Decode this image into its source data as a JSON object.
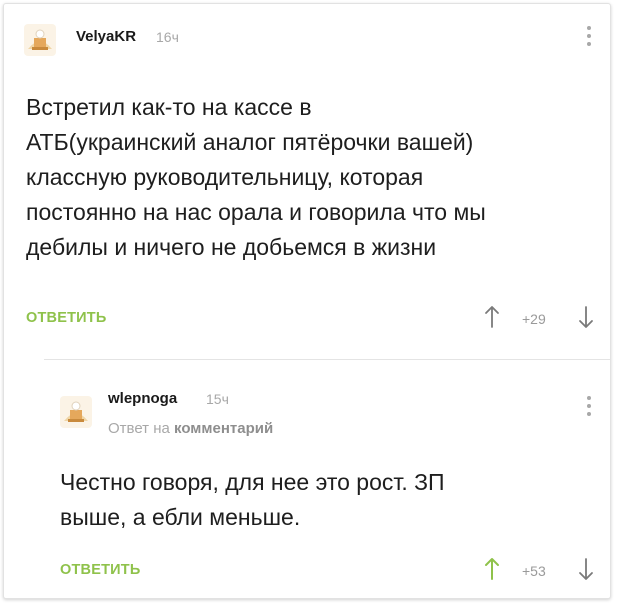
{
  "comment1": {
    "username": "VelyaKR",
    "time": "16ч",
    "text_lines": [
      "Встретил как-то на кассе в",
      "АТБ(украинский аналог пятёрочки вашей)",
      "классную руководительницу, которая",
      "постоянно на нас орала и говорила что мы",
      "дебилы и ничего не добьемся в жизни"
    ],
    "reply_label": "ОТВЕТИТЬ",
    "rating": "+29",
    "upvote_color": "#7a7a7a"
  },
  "comment2": {
    "username": "wlepnoga",
    "time": "15ч",
    "reply_to_prefix": "Ответ на",
    "reply_to_target": "комментарий",
    "text_lines": [
      "Честно говоря, для нее это рост. ЗП",
      "выше, а ебли меньше."
    ],
    "reply_label": "ОТВЕТИТЬ",
    "rating": "+53",
    "upvote_color": "#8fc24b"
  },
  "colors": {
    "accent_green": "#8fc24b",
    "muted_gray": "#a8a8a8",
    "text": "#1e1e1e"
  },
  "icons": [
    "avatar-icon",
    "more-options-icon",
    "arrow-up-icon",
    "arrow-down-icon"
  ]
}
